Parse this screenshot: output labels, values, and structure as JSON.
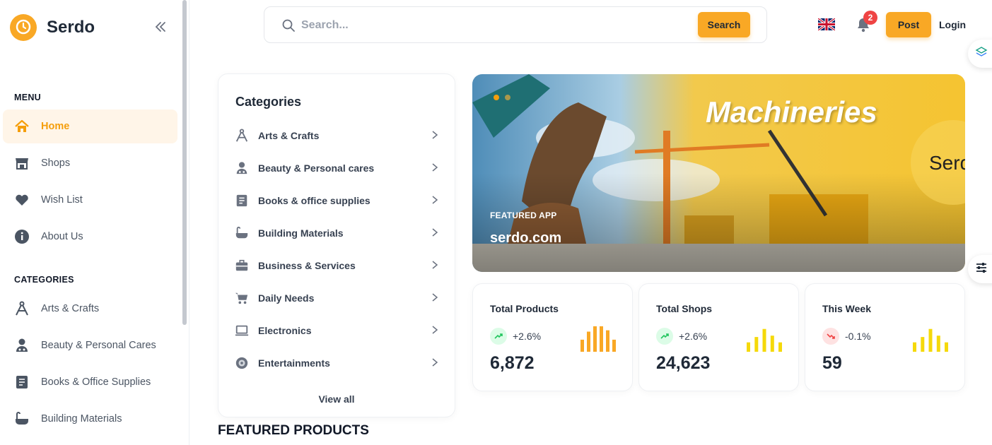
{
  "brand": {
    "name": "Serdo"
  },
  "sidebar": {
    "menu_title": "MENU",
    "menu": [
      {
        "label": "Home",
        "icon": "home-icon",
        "active": true
      },
      {
        "label": "Shops",
        "icon": "shop-icon"
      },
      {
        "label": "Wish List",
        "icon": "heart-icon"
      },
      {
        "label": "About Us",
        "icon": "info-icon"
      }
    ],
    "categories_title": "CATEGORIES",
    "categories": [
      {
        "label": "Arts & Crafts",
        "icon": "compass-icon"
      },
      {
        "label": "Beauty & Personal Cares",
        "icon": "person-icon"
      },
      {
        "label": "Books & Office Supplies",
        "icon": "book-icon"
      },
      {
        "label": "Building Materials",
        "icon": "bath-icon"
      }
    ]
  },
  "header": {
    "search_placeholder": "Search...",
    "search_button": "Search",
    "notifications": "2",
    "post_button": "Post",
    "login": "Login"
  },
  "categories_card": {
    "title": "Categories",
    "items": [
      {
        "label": "Arts & Crafts",
        "icon": "compass-icon"
      },
      {
        "label": "Beauty & Personal cares",
        "icon": "person-icon"
      },
      {
        "label": "Books & office supplies",
        "icon": "book-icon"
      },
      {
        "label": "Building Materials",
        "icon": "bath-icon"
      },
      {
        "label": "Business & Services",
        "icon": "briefcase-icon"
      },
      {
        "label": "Daily Needs",
        "icon": "cart-icon"
      },
      {
        "label": "Electronics",
        "icon": "monitor-icon"
      },
      {
        "label": "Entertainments",
        "icon": "disc-icon"
      }
    ],
    "view_all": "View all"
  },
  "banner": {
    "tag": "FEATURED APP",
    "title": "serdo.com",
    "headline": "Machineries",
    "brand_text": "Serd"
  },
  "stats": [
    {
      "label": "Total Products",
      "change": "+2.6%",
      "trend": "up",
      "value": "6,872",
      "bars": [
        0.45,
        0.75,
        0.95,
        0.95,
        0.8,
        0.45
      ]
    },
    {
      "label": "Total Shops",
      "change": "+2.6%",
      "trend": "up",
      "value": "24,623",
      "bars": [
        0.35,
        0.55,
        0.85,
        0.6,
        0.35
      ]
    },
    {
      "label": "This Week",
      "change": "-0.1%",
      "trend": "down",
      "value": "59",
      "bars": [
        0.35,
        0.55,
        0.85,
        0.6,
        0.35
      ]
    }
  ],
  "featured_title": "FEATURED PRODUCTS",
  "colors": {
    "accent": "#f9a825",
    "up": "#dcfce7",
    "down": "#fee2e2",
    "bars_orange": "#f9a825",
    "bars_yellow": "#f5d90a"
  }
}
